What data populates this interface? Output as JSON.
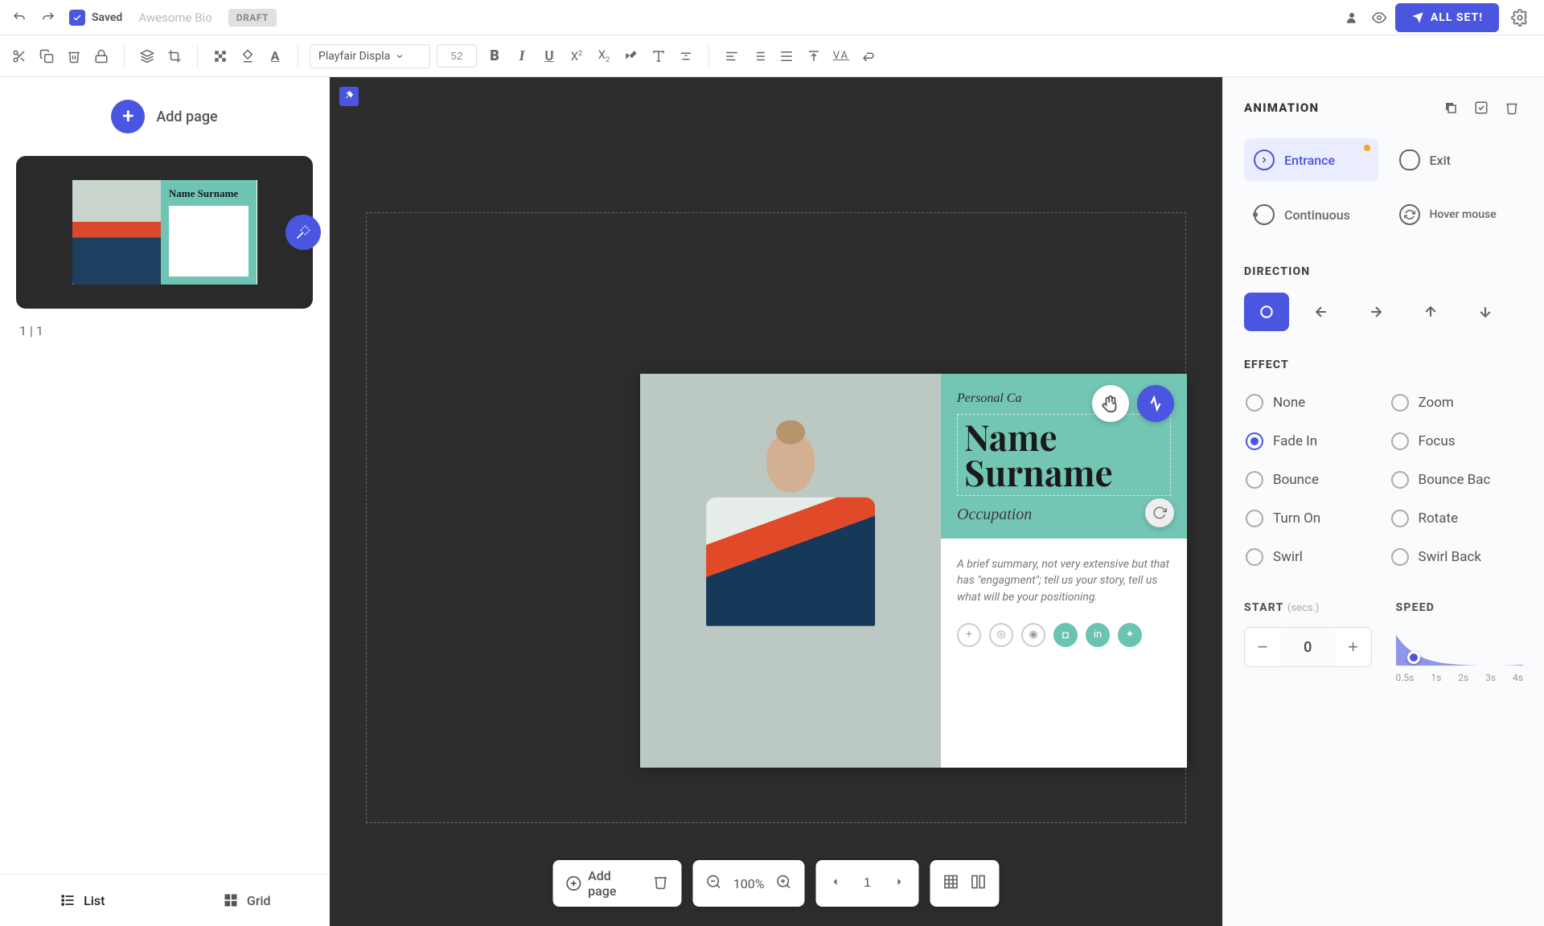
{
  "topbar": {
    "saved_label": "Saved",
    "doc_name": "Awesome Bio",
    "draft_badge": "DRAFT",
    "all_set_label": "ALL SET!"
  },
  "formatbar": {
    "font_family": "Playfair Displa",
    "font_size": "52"
  },
  "leftPanel": {
    "add_page_label": "Add page",
    "thumb_name": "Name Surname",
    "page_counter": "1 | 1",
    "view_list": "List",
    "view_grid": "Grid"
  },
  "canvas": {
    "card_label": "Personal Ca",
    "name_line": "Name Surname",
    "occupation": "Occupation",
    "desc": "A brief summary, not very extensive but that has \"engagment\"; tell us your story, tell us what will be your positioning."
  },
  "bottomTools": {
    "add_page": "Add page",
    "zoom": "100%",
    "page_num": "1"
  },
  "rightPanel": {
    "section_animation": "ANIMATION",
    "types": {
      "entrance": "Entrance",
      "exit": "Exit",
      "continuous": "Continuous",
      "hover": "Hover mouse"
    },
    "section_direction": "DIRECTION",
    "section_effect": "EFFECT",
    "effects": {
      "none": "None",
      "zoom": "Zoom",
      "fadein": "Fade In",
      "focus": "Focus",
      "bounce": "Bounce",
      "bounceback": "Bounce Bac",
      "turnon": "Turn On",
      "rotate": "Rotate",
      "swirl": "Swirl",
      "swirlback": "Swirl Back"
    },
    "start_label": "START",
    "start_unit": "(secs.)",
    "start_value": "0",
    "speed_label": "SPEED",
    "speed_ticks": [
      "0.5s",
      "1s",
      "2s",
      "3s",
      "4s"
    ]
  }
}
